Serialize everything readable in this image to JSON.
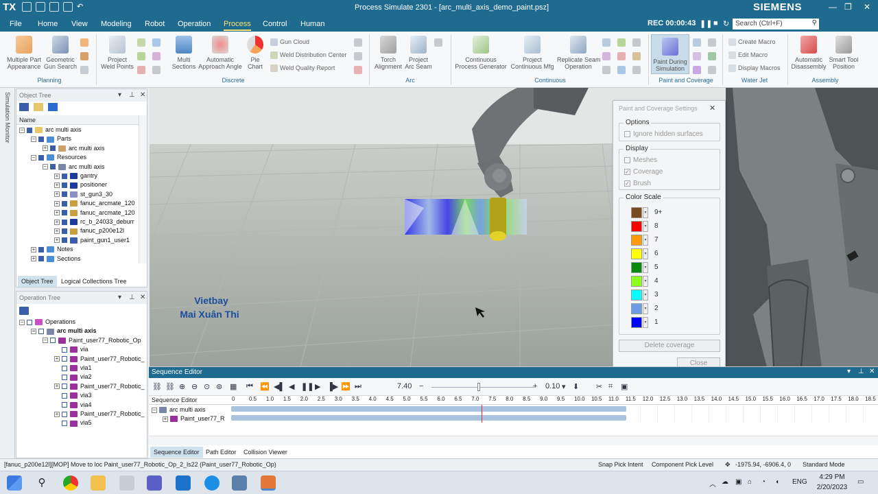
{
  "titlebar": {
    "logo": "TX",
    "title": "Process Simulate 2301 - [arc_multi_axis_demo_paint.psz]",
    "brand": "SIEMENS"
  },
  "menu": {
    "items": [
      "File",
      "Home",
      "View",
      "Modeling",
      "Robot",
      "Operation",
      "Process",
      "Control",
      "Human"
    ],
    "active": "Process",
    "rec_label": "REC 00:00:43",
    "search_placeholder": "Search (Ctrl+F)"
  },
  "ribbon": {
    "planning": {
      "label": "Planning",
      "multiple_part": "Multiple Part\nAppearance",
      "geometric_gun": "Geometric\nGun Search"
    },
    "discrete": {
      "label": "Discrete",
      "project_weld": "Project\nWeld Points",
      "multi_sections": "Multi\nSections",
      "auto_approach": "Automatic\nApproach Angle",
      "pie_chart": "Pie\nChart",
      "gun_cloud": "Gun Cloud",
      "weld_dist": "Weld Distribution Center",
      "weld_quality": "Weld Quality Report"
    },
    "arc": {
      "label": "Arc",
      "torch": "Torch\nAlignment",
      "project_arc": "Project\nArc Seam"
    },
    "continuous": {
      "label": "Continuous",
      "cont_gen": "Continuous\nProcess Generator",
      "project_cont": "Project\nContinuous Mfg",
      "replicate": "Replicate Seam\nOperation"
    },
    "paint": {
      "label": "Paint and Coverage",
      "paint_during": "Paint During\nSimulation"
    },
    "waterjet": {
      "label": "Water Jet",
      "create_macro": "Create Macro",
      "edit_macro": "Edit Macro",
      "display_macros": "Display Macros"
    },
    "assembly": {
      "label": "Assembly",
      "auto_disassembly": "Automatic\nDisassembly",
      "smart_tool": "Smart Tool\nPosition"
    }
  },
  "sidebar_label": "Simulation Monitor",
  "object_tree": {
    "title": "Object Tree",
    "column": "Name",
    "rows": [
      {
        "label": "arc multi axis",
        "indent": 0,
        "exp": "−"
      },
      {
        "label": "Parts",
        "indent": 1,
        "exp": "−"
      },
      {
        "label": "arc multi axis",
        "indent": 2,
        "exp": "+"
      },
      {
        "label": "Resources",
        "indent": 1,
        "exp": "−"
      },
      {
        "label": "arc multi axis",
        "indent": 2,
        "exp": "−"
      },
      {
        "label": "gantry",
        "indent": 3,
        "exp": "+"
      },
      {
        "label": "positioner",
        "indent": 3,
        "exp": "+"
      },
      {
        "label": "st_gun3_30",
        "indent": 3,
        "exp": "+"
      },
      {
        "label": "fanuc_arcmate_120",
        "indent": 3,
        "exp": "+"
      },
      {
        "label": "fanuc_arcmate_120",
        "indent": 3,
        "exp": "+"
      },
      {
        "label": "rc_b_24033_deburr",
        "indent": 3,
        "exp": "+"
      },
      {
        "label": "fanuc_p200e12l",
        "indent": 3,
        "exp": "+"
      },
      {
        "label": "paint_gun1_user1",
        "indent": 3,
        "exp": "+"
      },
      {
        "label": "Notes",
        "indent": 1,
        "exp": "+"
      },
      {
        "label": "Sections",
        "indent": 1,
        "exp": "+"
      }
    ],
    "tab1": "Object Tree",
    "tab2": "Logical Collections Tree"
  },
  "operation_tree": {
    "title": "Operation Tree",
    "rows": [
      {
        "label": "Operations",
        "indent": 0,
        "exp": "−",
        "bold": false
      },
      {
        "label": "arc multi axis",
        "indent": 1,
        "exp": "−",
        "bold": true
      },
      {
        "label": "Paint_user77_Robotic_Op",
        "indent": 2,
        "exp": "−",
        "bold": false
      },
      {
        "label": "via",
        "indent": 3,
        "exp": "",
        "bold": false
      },
      {
        "label": "Paint_user77_Robotic_",
        "indent": 3,
        "exp": "+",
        "bold": false
      },
      {
        "label": "via1",
        "indent": 3,
        "exp": "",
        "bold": false
      },
      {
        "label": "via2",
        "indent": 3,
        "exp": "",
        "bold": false
      },
      {
        "label": "Paint_user77_Robotic_",
        "indent": 3,
        "exp": "+",
        "bold": false
      },
      {
        "label": "via3",
        "indent": 3,
        "exp": "",
        "bold": false
      },
      {
        "label": "via4",
        "indent": 3,
        "exp": "",
        "bold": false
      },
      {
        "label": "Paint_user77_Robotic_",
        "indent": 3,
        "exp": "+",
        "bold": false
      },
      {
        "label": "via5",
        "indent": 3,
        "exp": "",
        "bold": false
      }
    ]
  },
  "viewport": {
    "watermark_line1": "Vietbay",
    "watermark_line2": "Mai Xuân Thi"
  },
  "paint_dialog": {
    "title": "Paint and Coverage Settings",
    "options_legend": "Options",
    "ignore_hidden": "Ignore hidden surfaces",
    "display_legend": "Display",
    "meshes": "Meshes",
    "coverage": "Coverage",
    "brush": "Brush",
    "color_scale_legend": "Color Scale",
    "scale": [
      {
        "label": "9+",
        "color": "#7a4a1e"
      },
      {
        "label": "8",
        "color": "#ff0000"
      },
      {
        "label": "7",
        "color": "#ff9a00"
      },
      {
        "label": "6",
        "color": "#ffff00"
      },
      {
        "label": "5",
        "color": "#0a8a0a"
      },
      {
        "label": "4",
        "color": "#8cff1a"
      },
      {
        "label": "3",
        "color": "#00ffff"
      },
      {
        "label": "2",
        "color": "#6a9ce8"
      },
      {
        "label": "1",
        "color": "#0000ff"
      }
    ],
    "delete_coverage": "Delete coverage",
    "close": "Close"
  },
  "sequence_editor": {
    "title": "Sequence Editor",
    "time": "7.40",
    "step": "0.10",
    "column": "Sequence Editor",
    "row1": "arc multi axis",
    "row2": "Paint_user77_R",
    "ticks": [
      "0",
      "0.5",
      "1.0",
      "1.5",
      "2.0",
      "2.5",
      "3.0",
      "3.5",
      "4.0",
      "4.5",
      "5.0",
      "5.5",
      "6.0",
      "6.5",
      "7.0",
      "7.5",
      "8.0",
      "8.5",
      "9.0",
      "9.5",
      "10.0",
      "10.5",
      "11.0",
      "11.5",
      "12.0",
      "12.5",
      "13.0",
      "13.5",
      "14.0",
      "14.5",
      "15.0",
      "15.5",
      "16.0",
      "16.5",
      "17.0",
      "17.5",
      "18.0",
      "18.5"
    ],
    "tab1": "Sequence Editor",
    "tab2": "Path Editor",
    "tab3": "Collision Viewer"
  },
  "status": {
    "message": "[fanuc_p200e12l][MOP] Move to loc Paint_user77_Robotic_Op_2_ls22 (Paint_user77_Robotic_Op)",
    "snap": "Snap Pick Intent",
    "pick_level": "Component Pick Level",
    "coords": "-1975.94, -6906.4, 0",
    "mode": "Standard Mode"
  },
  "taskbar": {
    "lang": "ENG",
    "time": "4:29 PM",
    "date": "2/20/2023"
  }
}
